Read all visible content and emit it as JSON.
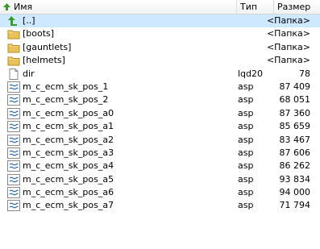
{
  "columns": {
    "name": "Имя",
    "type": "Тип",
    "size": "Размер"
  },
  "files": [
    {
      "name": "[..]",
      "type": "",
      "size": "<Папка>",
      "icon": "up-arrow-icon"
    },
    {
      "name": "[boots]",
      "type": "",
      "size": "<Папка>",
      "icon": "folder-icon"
    },
    {
      "name": "[gauntlets]",
      "type": "",
      "size": "<Папка>",
      "icon": "folder-icon"
    },
    {
      "name": "[helmets]",
      "type": "",
      "size": "<Папка>",
      "icon": "folder-icon"
    },
    {
      "name": "dir",
      "type": "lqd20",
      "size": "78",
      "icon": "file-icon"
    },
    {
      "name": "m_c_ecm_sk_pos_1",
      "type": "asp",
      "size": "87 409",
      "icon": "script-file-icon"
    },
    {
      "name": "m_c_ecm_sk_pos_2",
      "type": "asp",
      "size": "68 051",
      "icon": "script-file-icon"
    },
    {
      "name": "m_c_ecm_sk_pos_a0",
      "type": "asp",
      "size": "87 360",
      "icon": "script-file-icon"
    },
    {
      "name": "m_c_ecm_sk_pos_a1",
      "type": "asp",
      "size": "85 659",
      "icon": "script-file-icon"
    },
    {
      "name": "m_c_ecm_sk_pos_a2",
      "type": "asp",
      "size": "83 467",
      "icon": "script-file-icon"
    },
    {
      "name": "m_c_ecm_sk_pos_a3",
      "type": "asp",
      "size": "87 606",
      "icon": "script-file-icon"
    },
    {
      "name": "m_c_ecm_sk_pos_a4",
      "type": "asp",
      "size": "86 262",
      "icon": "script-file-icon"
    },
    {
      "name": "m_c_ecm_sk_pos_a5",
      "type": "asp",
      "size": "93 834",
      "icon": "script-file-icon"
    },
    {
      "name": "m_c_ecm_sk_pos_a6",
      "type": "asp",
      "size": "94 000",
      "icon": "script-file-icon"
    },
    {
      "name": "m_c_ecm_sk_pos_a7",
      "type": "asp",
      "size": "71 794",
      "icon": "script-file-icon"
    }
  ],
  "colors": {
    "selection": "#cde8ff",
    "up_arrow": "#3a9a2c",
    "folder": "#e9c25a"
  }
}
